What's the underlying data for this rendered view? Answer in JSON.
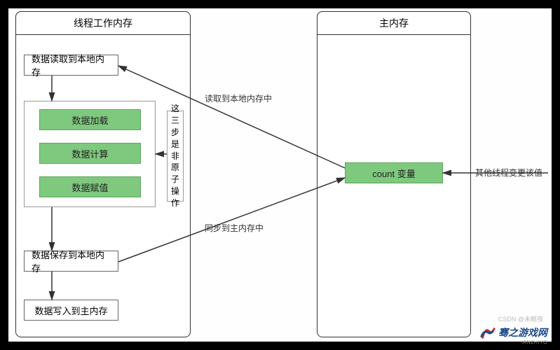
{
  "left_panel": {
    "title": "线程工作内存",
    "box_read_local": "数据读取到本地内存",
    "green_load": "数据加载",
    "green_compute": "数据计算",
    "green_assign": "数据赋值",
    "box_save_local": "数据保存到本地内存",
    "box_write_main": "数据写入到主内存"
  },
  "right_panel": {
    "title": "主内存",
    "count_var": "count 变量"
  },
  "vertical_note": "这三步是非原子操作",
  "labels": {
    "read_to_local": "读取到本地内存中",
    "sync_to_main": "同步到主内存中",
    "other_thread": "其他线程变更该值"
  },
  "watermark": {
    "main": "骞之游戏网",
    "sub": "IANZHIYO",
    "csdn": "CSDN @未眠夜"
  }
}
